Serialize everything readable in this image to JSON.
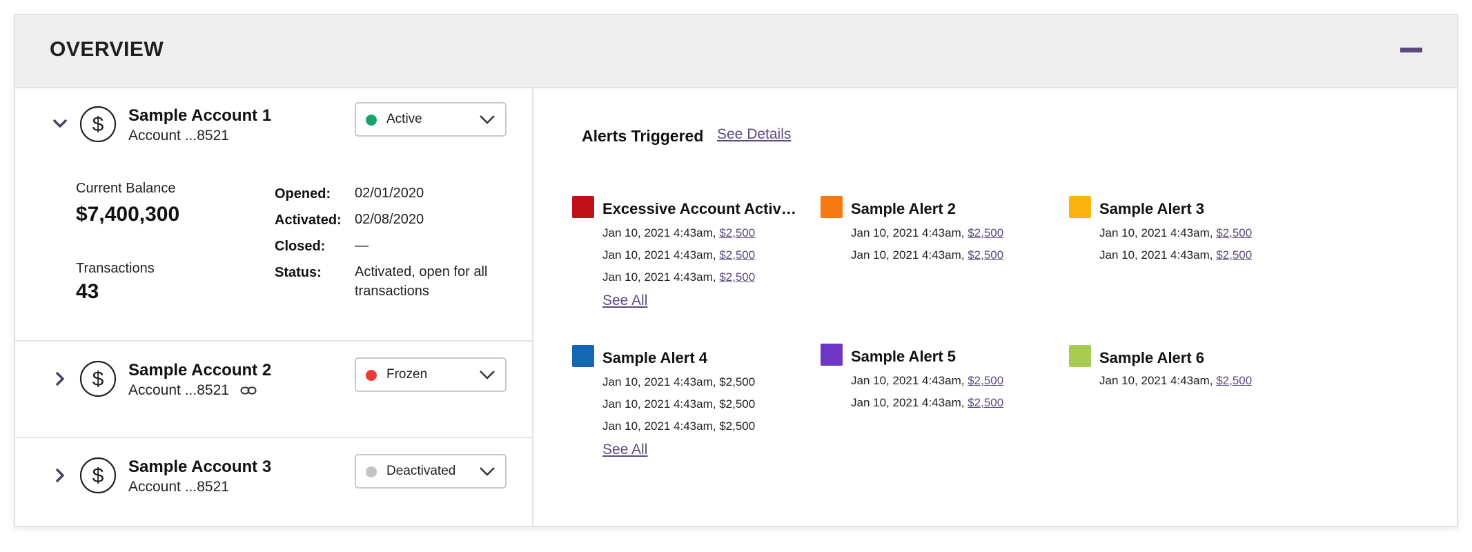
{
  "header": {
    "title": "OVERVIEW"
  },
  "accounts": [
    {
      "name": "Sample Account 1",
      "number": "Account ...8521",
      "status": "Active",
      "status_color": "#1aa36b",
      "expanded": true,
      "balance_label": "Current Balance",
      "balance": "$7,400,300",
      "transactions_label": "Transactions",
      "transactions": "43",
      "details": {
        "opened_label": "Opened:",
        "opened": "02/01/2020",
        "activated_label": "Activated:",
        "activated": "02/08/2020",
        "closed_label": "Closed:",
        "closed": "—",
        "status_label": "Status:",
        "status_text": "Activated, open for all transactions"
      }
    },
    {
      "name": "Sample Account 2",
      "number": "Account ...8521",
      "status": "Frozen",
      "status_color": "#f03a3a",
      "expanded": false,
      "linked": true
    },
    {
      "name": "Sample Account 3",
      "number": "Account ...8521",
      "status": "Deactivated",
      "status_color": "#c4c4c4",
      "expanded": false
    }
  ],
  "alerts_panel": {
    "title": "Alerts Triggered",
    "see_details": "See Details",
    "see_all": "See All",
    "alerts": [
      {
        "title": "Excessive Account Activi...",
        "color": "#c0101a",
        "entries": [
          {
            "time": "Jan 10, 2021 4:43am,",
            "amount": "$2,500",
            "linked": true
          },
          {
            "time": "Jan 10, 2021 4:43am,",
            "amount": "$2,500",
            "linked": true
          },
          {
            "time": "Jan 10, 2021 4:43am,",
            "amount": "$2,500",
            "linked": true
          }
        ],
        "see_all": true
      },
      {
        "title": "Sample Alert 2",
        "color": "#f57a14",
        "entries": [
          {
            "time": "Jan 10, 2021 4:43am,",
            "amount": "$2,500",
            "linked": true
          },
          {
            "time": "Jan 10, 2021 4:43am,",
            "amount": "$2,500",
            "linked": true
          }
        ],
        "see_all": false
      },
      {
        "title": "Sample Alert 3",
        "color": "#fbb40f",
        "entries": [
          {
            "time": "Jan 10, 2021 4:43am,",
            "amount": "$2,500",
            "linked": true
          },
          {
            "time": "Jan 10, 2021 4:43am,",
            "amount": "$2,500",
            "linked": true
          }
        ],
        "see_all": false
      },
      {
        "title": "Sample Alert 4",
        "color": "#1667b3",
        "entries": [
          {
            "time": "Jan 10, 2021 4:43am,",
            "amount": "$2,500",
            "linked": false
          },
          {
            "time": "Jan 10, 2021 4:43am,",
            "amount": "$2,500",
            "linked": false
          },
          {
            "time": "Jan 10, 2021 4:43am,",
            "amount": "$2,500",
            "linked": false
          }
        ],
        "see_all": true
      },
      {
        "title": "Sample Alert 5",
        "color": "#6c36c3",
        "entries": [
          {
            "time": "Jan 10, 2021 4:43am,",
            "amount": "$2,500",
            "linked": true
          },
          {
            "time": "Jan 10, 2021 4:43am,",
            "amount": "$2,500",
            "linked": true
          }
        ],
        "see_all": false
      },
      {
        "title": "Sample Alert 6",
        "color": "#a8cc52",
        "entries": [
          {
            "time": "Jan 10, 2021 4:43am,",
            "amount": "$2,500",
            "linked": true
          }
        ],
        "see_all": false
      }
    ]
  }
}
